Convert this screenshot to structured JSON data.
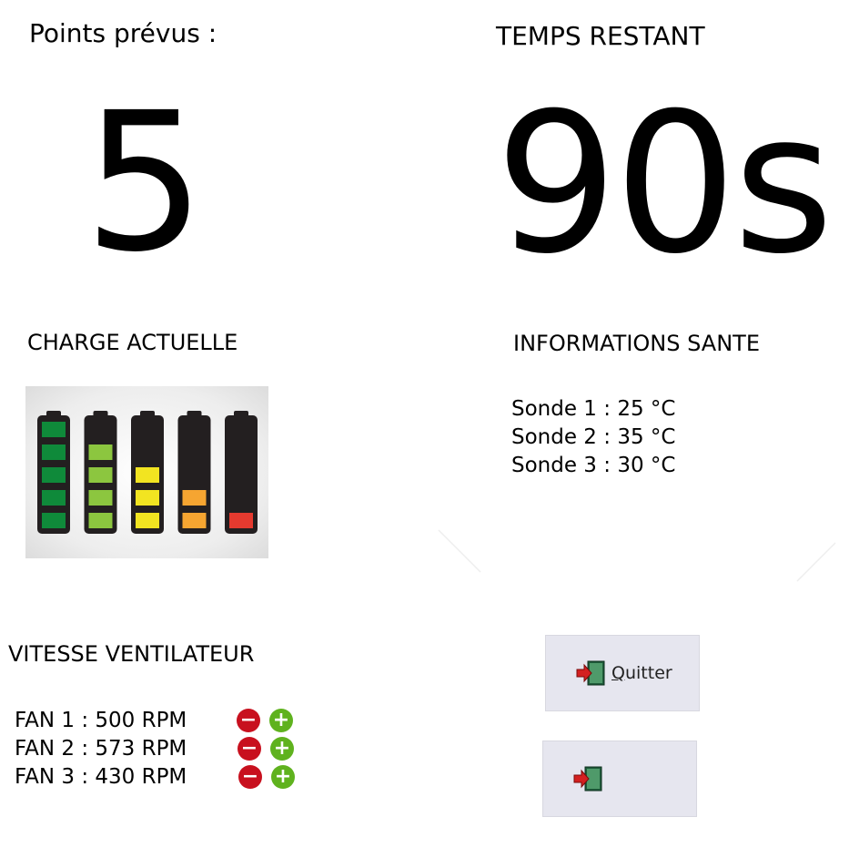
{
  "points": {
    "label": "Points prévus :",
    "value": "5"
  },
  "timer": {
    "label": "TEMPS RESTANT",
    "value": "90s"
  },
  "charge": {
    "label": "CHARGE ACTUELLE",
    "batteries": [
      {
        "bars": 5,
        "color": "#0f8a3a"
      },
      {
        "bars": 4,
        "color": "#8cc63f"
      },
      {
        "bars": 3,
        "color": "#f2e421"
      },
      {
        "bars": 2,
        "color": "#f6a531"
      },
      {
        "bars": 1,
        "color": "#e53a2f"
      }
    ]
  },
  "health": {
    "label": "INFORMATIONS SANTE",
    "probes": [
      "Sonde 1 : 25 °C",
      "Sonde 2 : 35 °C",
      "Sonde 3 : 30 °C"
    ]
  },
  "fans": {
    "label": "VITESSE VENTILATEUR",
    "items": [
      "FAN 1 : 500 RPM",
      "FAN 2 : 573 RPM",
      "FAN 3 : 430 RPM"
    ],
    "minus_symbol": "−",
    "plus_symbol": "+"
  },
  "buttons": {
    "quit_label": "Quitter",
    "quit_mnemonic": "Q",
    "quit_rest": "uitter"
  }
}
